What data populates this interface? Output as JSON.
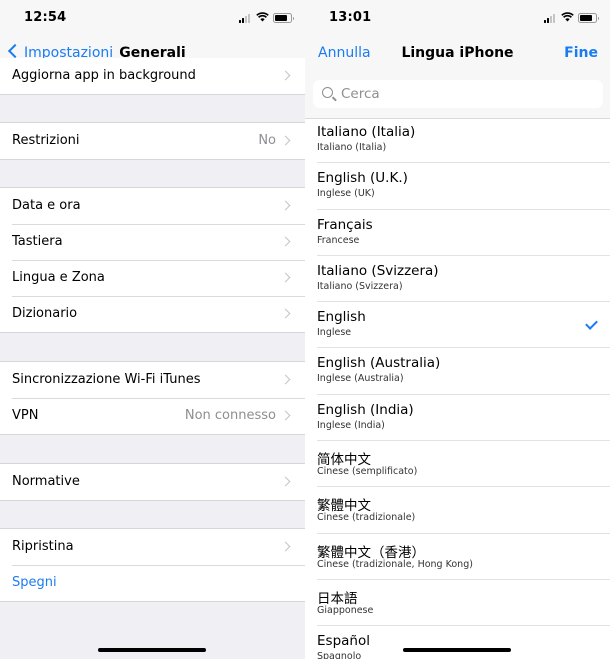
{
  "left": {
    "status": {
      "time": "12:54"
    },
    "nav": {
      "back_label": "Impostazioni",
      "title": "Generali"
    },
    "groups": [
      {
        "rows": [
          {
            "label": "Aggiorna app in background",
            "value": ""
          }
        ]
      },
      {
        "rows": [
          {
            "label": "Restrizioni",
            "value": "No"
          }
        ]
      },
      {
        "rows": [
          {
            "label": "Data e ora",
            "value": ""
          },
          {
            "label": "Tastiera",
            "value": ""
          },
          {
            "label": "Lingua e Zona",
            "value": ""
          },
          {
            "label": "Dizionario",
            "value": ""
          }
        ]
      },
      {
        "rows": [
          {
            "label": "Sincronizzazione Wi-Fi iTunes",
            "value": ""
          },
          {
            "label": "VPN",
            "value": "Non connesso"
          }
        ]
      },
      {
        "rows": [
          {
            "label": "Normative",
            "value": ""
          }
        ]
      },
      {
        "rows": [
          {
            "label": "Ripristina",
            "value": ""
          },
          {
            "label": "Spegni",
            "value": ""
          }
        ]
      }
    ]
  },
  "right": {
    "status": {
      "time": "13:01"
    },
    "nav": {
      "cancel_label": "Annulla",
      "title": "Lingua iPhone",
      "done_label": "Fine"
    },
    "search": {
      "placeholder": "Cerca",
      "value": ""
    },
    "languages": [
      {
        "name": "Italiano (Italia)",
        "sub": "Italiano (Italia)"
      },
      {
        "name": "English (U.K.)",
        "sub": "Inglese (UK)"
      },
      {
        "name": "Français",
        "sub": "Francese"
      },
      {
        "name": "Italiano (Svizzera)",
        "sub": "Italiano (Svizzera)"
      },
      {
        "name": "English",
        "sub": "Inglese",
        "selected": true
      },
      {
        "name": "English (Australia)",
        "sub": "Inglese (Australia)"
      },
      {
        "name": "English (India)",
        "sub": "Inglese (India)"
      },
      {
        "name": "简体中文",
        "sub": "Cinese (semplificato)"
      },
      {
        "name": "繁體中文",
        "sub": "Cinese (tradizionale)"
      },
      {
        "name": "繁體中文（香港）",
        "sub": "Cinese (tradizionale, Hong Kong)"
      },
      {
        "name": "日本語",
        "sub": "Giapponese"
      },
      {
        "name": "Español",
        "sub": "Spagnolo"
      }
    ]
  },
  "colors": {
    "accent": "#1a7cf2",
    "grouped_background": "#efeff4",
    "secondary_text": "#8e8e93"
  }
}
